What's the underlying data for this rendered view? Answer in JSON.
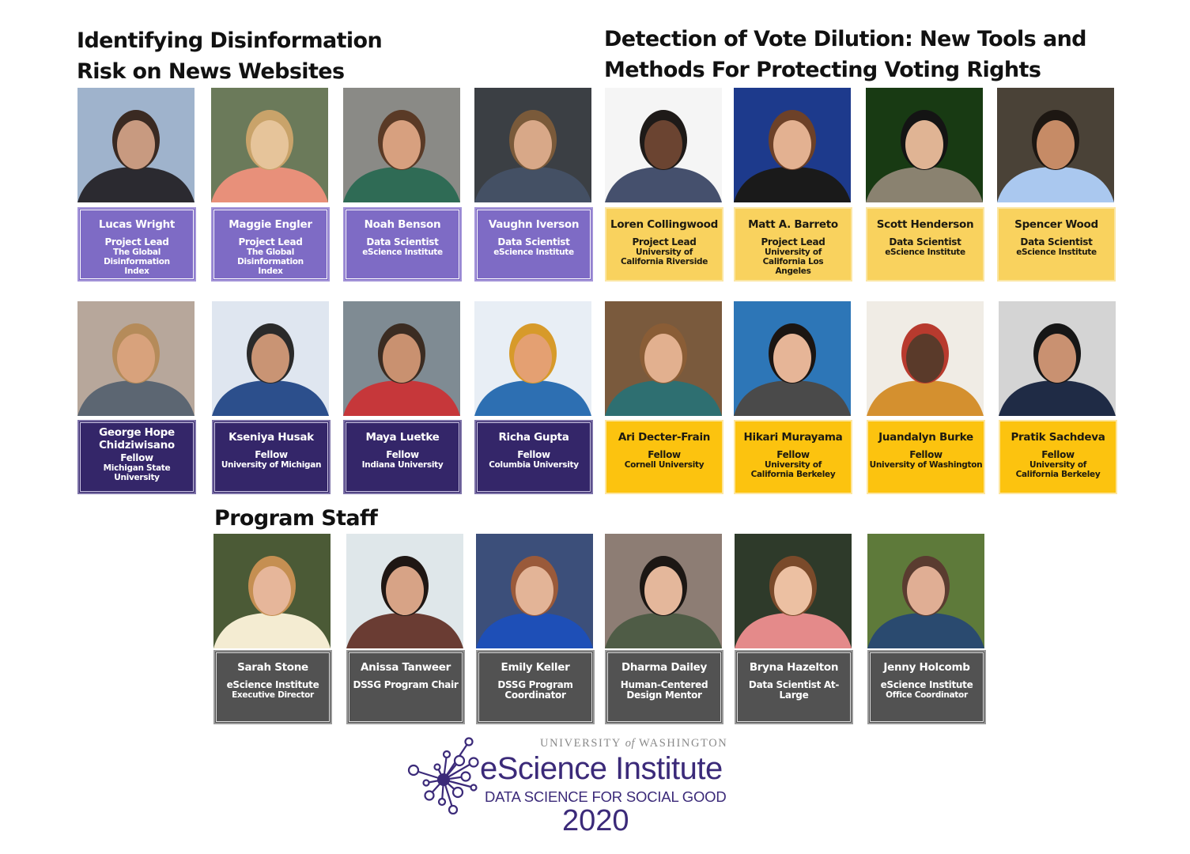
{
  "sections": {
    "disinformation": {
      "title": "Identifying Disinformation Risk on News Websites",
      "color_leads": "#7e6bc5",
      "color_fellows": "#342669",
      "members": [
        {
          "name": "Lucas Wright",
          "role": "Project Lead",
          "org": "The Global Disinformation Index"
        },
        {
          "name": "Maggie Engler",
          "role": "Project Lead",
          "org": "The Global Disinformation Index"
        },
        {
          "name": "Noah Benson",
          "role": "Data Scientist",
          "org": "eScience Institute"
        },
        {
          "name": "Vaughn Iverson",
          "role": "Data Scientist",
          "org": "eScience Institute"
        },
        {
          "name": "George Hope Chidziwisano",
          "role": "Fellow",
          "org": "Michigan State University"
        },
        {
          "name": "Kseniya Husak",
          "role": "Fellow",
          "org": "University of Michigan"
        },
        {
          "name": "Maya Luetke",
          "role": "Fellow",
          "org": "Indiana University"
        },
        {
          "name": "Richa Gupta",
          "role": "Fellow",
          "org": "Columbia University"
        }
      ]
    },
    "vote_dilution": {
      "title": "Detection of Vote Dilution: New Tools and Methods For Protecting Voting Rights",
      "color_leads": "#f9d25e",
      "color_fellows": "#fcc30f",
      "members": [
        {
          "name": "Loren Collingwood",
          "role": "Project Lead",
          "org": "University of California Riverside"
        },
        {
          "name": "Matt A. Barreto",
          "role": "Project Lead",
          "org": "University of California Los Angeles"
        },
        {
          "name": "Scott Henderson",
          "role": "Data Scientist",
          "org": "eScience Institute"
        },
        {
          "name": "Spencer Wood",
          "role": "Data Scientist",
          "org": "eScience Institute"
        },
        {
          "name": "Ari Decter-Frain",
          "role": "Fellow",
          "org": "Cornell University"
        },
        {
          "name": "Hikari Murayama",
          "role": "Fellow",
          "org": "University of California Berkeley"
        },
        {
          "name": "Juandalyn Burke",
          "role": "Fellow",
          "org": "University of Washington"
        },
        {
          "name": "Pratik Sachdeva",
          "role": "Fellow",
          "org": "University of California Berkeley"
        }
      ]
    },
    "staff": {
      "title": "Program Staff",
      "color": "#525252",
      "members": [
        {
          "name": "Sarah Stone",
          "role": "eScience Institute",
          "org": "Executive Director"
        },
        {
          "name": "Anissa Tanweer",
          "role": "DSSG Program Chair",
          "org": ""
        },
        {
          "name": "Emily Keller",
          "role": "DSSG Program Coordinator",
          "org": ""
        },
        {
          "name": "Dharma Dailey",
          "role": "Human-Centered Design Mentor",
          "org": ""
        },
        {
          "name": "Bryna Hazelton",
          "role": "Data Scientist At-Large",
          "org": ""
        },
        {
          "name": "Jenny Holcomb",
          "role": "eScience Institute",
          "org": "Office Coordinator"
        }
      ]
    }
  },
  "logo": {
    "university_prefix": "UNIVERSITY",
    "university_of": "of",
    "university_suffix": "WASHINGTON",
    "institute": "eScience Institute",
    "program": "DATA SCIENCE FOR SOCIAL GOOD",
    "year": "2020",
    "brand_color": "#3b2a79"
  }
}
